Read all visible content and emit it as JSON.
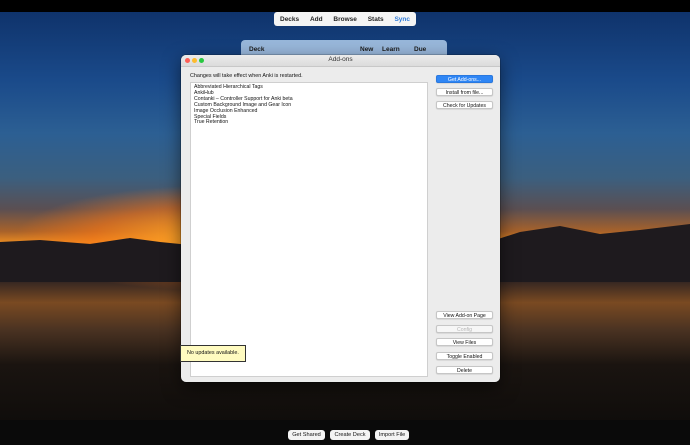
{
  "top_toolbar": {
    "items": [
      "Decks",
      "Add",
      "Browse",
      "Stats",
      "Sync"
    ]
  },
  "deck_table": {
    "col_deck": "Deck",
    "col_new": "New",
    "col_learn": "Learn",
    "col_due": "Due"
  },
  "addons_window": {
    "title": "Add-ons",
    "notice": "Changes will take effect when Anki is restarted.",
    "addons": [
      "Abbreviated Hierarchical Tags",
      "AnkiHub",
      "Contanki – Controller Support for Anki beta",
      "Custom Background Image and Gear Icon",
      "Image Occlusion Enhanced",
      "Special Fields",
      "True Retention"
    ],
    "buttons": {
      "get_addons": "Get Add-ons...",
      "install_from_file": "Install from file...",
      "check_updates": "Check for Updates",
      "view_addon_page": "View Add-on Page",
      "config": "Config",
      "view_files": "View Files",
      "toggle_enabled": "Toggle Enabled",
      "delete": "Delete"
    },
    "tooltip": "No updates available."
  },
  "bottom_toolbar": {
    "get_shared": "Get Shared",
    "create_deck": "Create Deck",
    "import_file": "Import File"
  },
  "colors": {
    "accent": "#2f86f5",
    "sync_link": "#2f7bd9",
    "tooltip_bg": "#fffbc0"
  }
}
